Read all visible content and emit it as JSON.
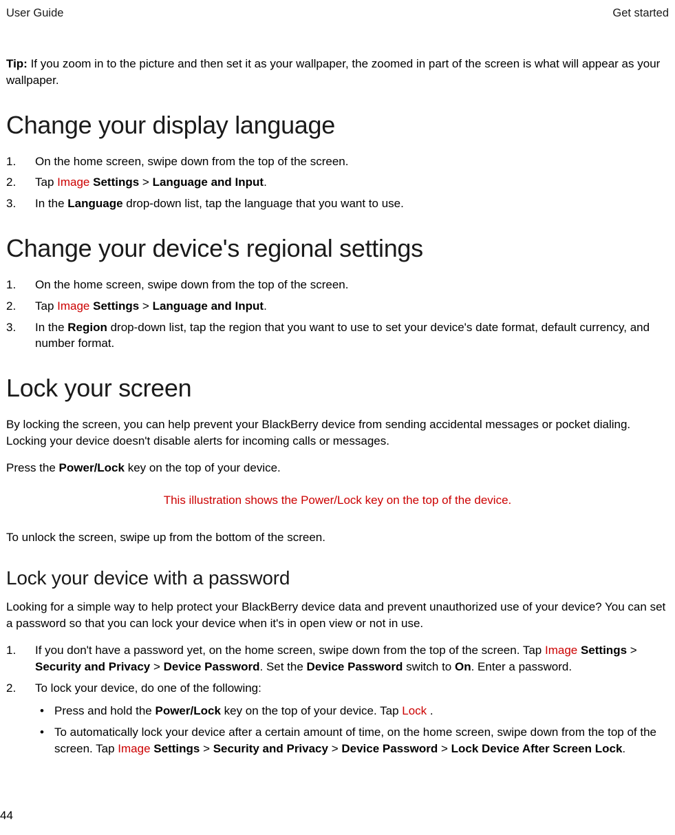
{
  "header": {
    "left": "User Guide",
    "right": "Get started"
  },
  "tip": {
    "label": "Tip:",
    "text": " If you zoom in to the picture and then set it as your wallpaper, the zoomed in part of the screen is what will appear as your wallpaper."
  },
  "section1": {
    "title": "Change your display language",
    "step1": "On the home screen, swipe down from the top of the screen.",
    "step2_a": "Tap ",
    "step2_img": " Image ",
    "step2_b": " Settings",
    "step2_c": " > ",
    "step2_d": "Language and Input",
    "step2_e": ".",
    "step3_a": "In the ",
    "step3_b": "Language",
    "step3_c": " drop-down list, tap the language that you want to use."
  },
  "section2": {
    "title": "Change your device's regional settings",
    "step1": "On the home screen, swipe down from the top of the screen.",
    "step2_a": "Tap ",
    "step2_img": " Image ",
    "step2_b": " Settings",
    "step2_c": " > ",
    "step2_d": "Language and Input",
    "step2_e": ".",
    "step3_a": "In the ",
    "step3_b": "Region",
    "step3_c": " drop-down list, tap the region that you want to use to set your device's date format, default currency, and number format."
  },
  "section3": {
    "title": "Lock your screen",
    "intro": "By locking the screen, you can help prevent your BlackBerry device from sending accidental messages or pocket dialing. Locking your device doesn't disable alerts for incoming calls or messages.",
    "press_a": "Press the ",
    "press_b": "Power/Lock",
    "press_c": " key on the top of your device.",
    "illustration": "This illustration shows the Power/Lock key on the top of the device.",
    "unlock": "To unlock the screen, swipe up from the bottom of the screen."
  },
  "section4": {
    "title": "Lock your device with a password",
    "intro": "Looking for a simple way to help protect your BlackBerry device data and prevent unauthorized use of your device? You can set a password so that you can lock your device when it's in open view or not in use.",
    "step1_a": "If you don't have a password yet, on the home screen, swipe down from the top of the screen. Tap ",
    "step1_img": " Image ",
    "step1_b": " Settings",
    "step1_c": " > ",
    "step1_d": "Security and Privacy",
    "step1_e": " > ",
    "step1_f": "Device Password",
    "step1_g": ". Set the ",
    "step1_h": "Device Password",
    "step1_i": " switch to ",
    "step1_j": "On",
    "step1_k": ". Enter a password.",
    "step2": "To lock your device, do one of the following:",
    "bullet1_a": "Press and hold the ",
    "bullet1_b": "Power/Lock",
    "bullet1_c": " key on the top of your device. Tap ",
    "bullet1_lock": " Lock ",
    "bullet1_d": ".",
    "bullet2_a": "To automatically lock your device after a certain amount of time, on the home screen, swipe down from the top of the screen. Tap ",
    "bullet2_img": " Image ",
    "bullet2_b": " Settings",
    "bullet2_c": " > ",
    "bullet2_d": "Security and Privacy",
    "bullet2_e": " > ",
    "bullet2_f": "Device Password",
    "bullet2_g": " > ",
    "bullet2_h": "Lock Device After Screen Lock",
    "bullet2_i": "."
  },
  "pageNum": "44",
  "numbers": {
    "n1": "1.",
    "n2": "2.",
    "n3": "3."
  },
  "bullet": "•"
}
